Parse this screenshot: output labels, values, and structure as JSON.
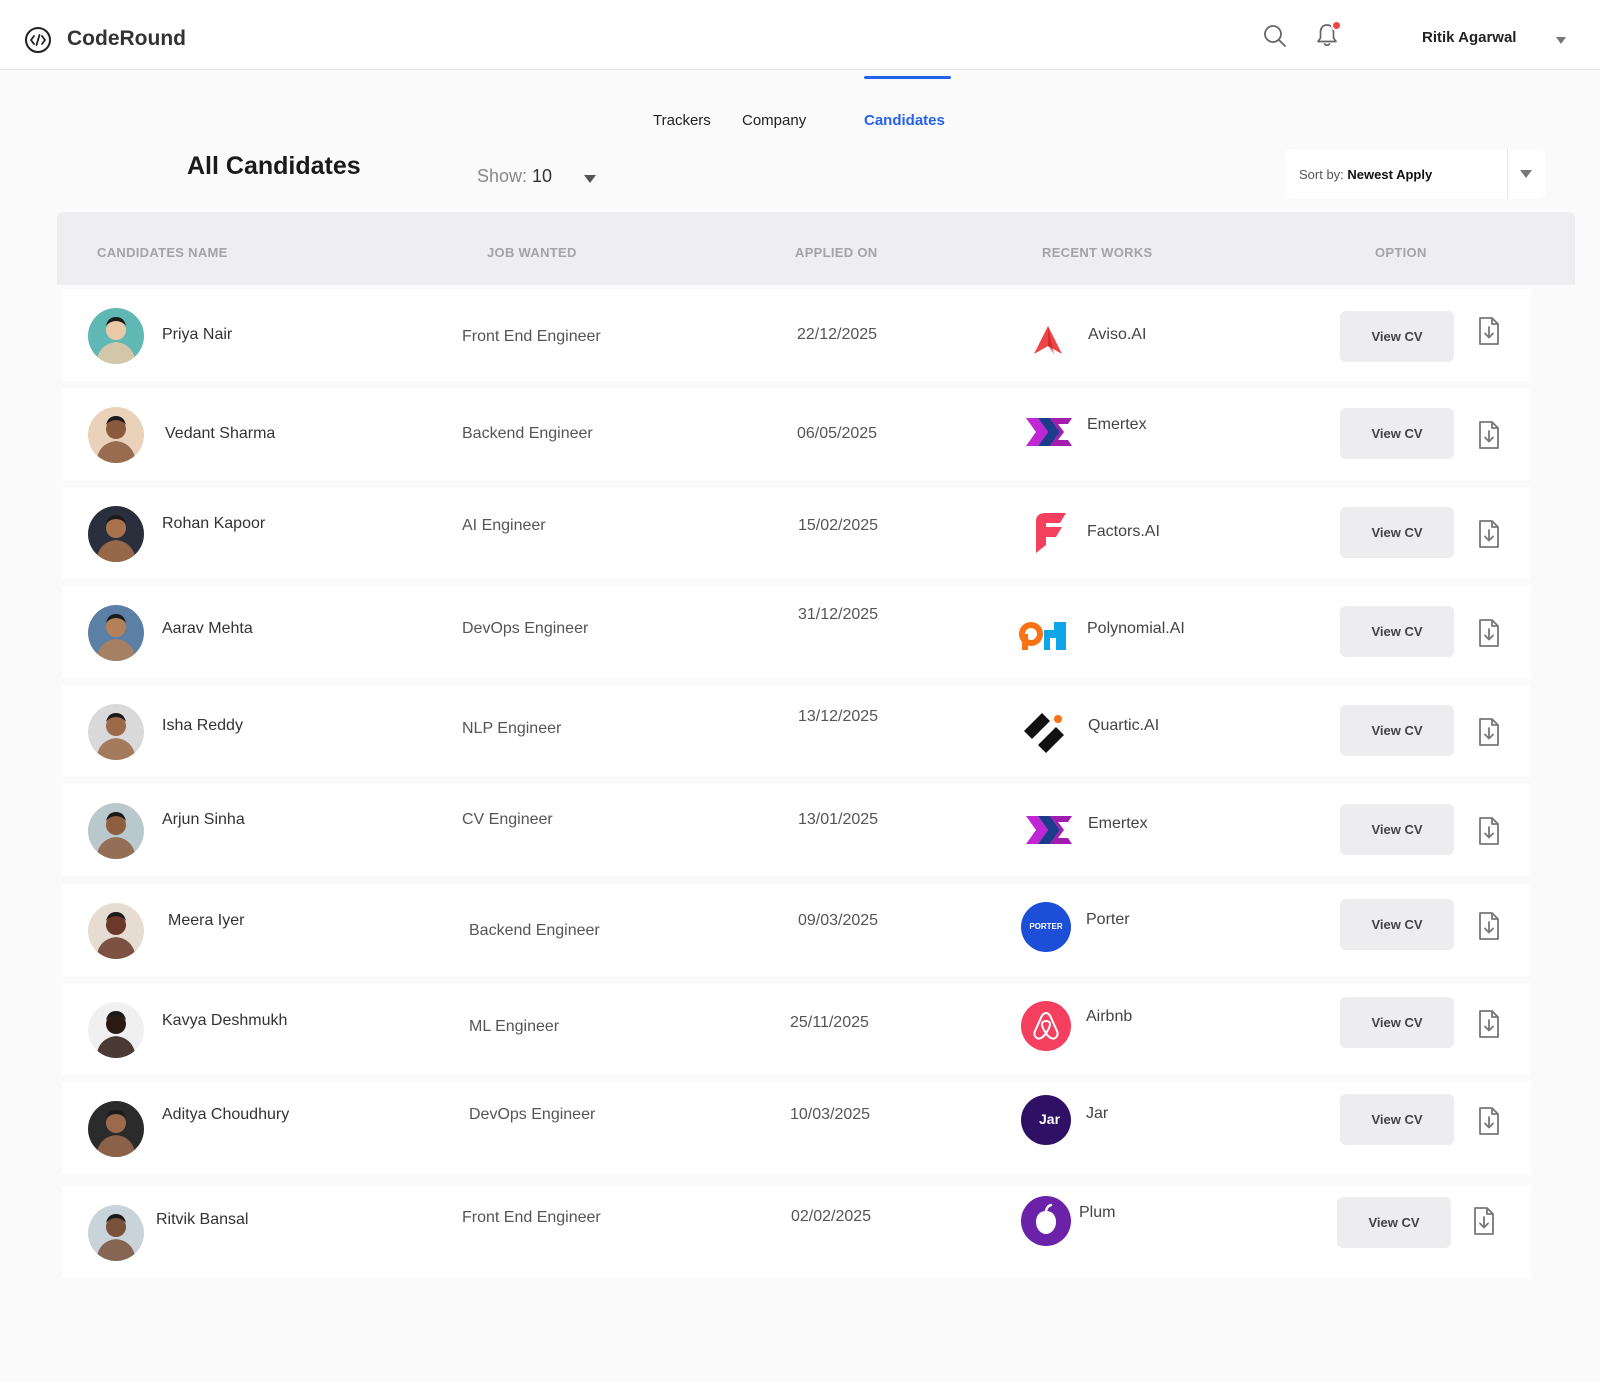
{
  "header": {
    "brand": "CodeRound",
    "user_name": "Ritik Agarwal"
  },
  "tabs": {
    "trackers": "Trackers",
    "company": "Company",
    "candidates": "Candidates"
  },
  "page": {
    "title": "All Candidates",
    "show_label": "Show:",
    "show_value": "10",
    "sort_label": "Sort by:",
    "sort_value": "Newest Apply"
  },
  "table": {
    "columns": [
      "CANDIDATES NAME",
      "JOB WANTED",
      "APPLIED ON",
      "RECENT WORKS",
      "OPTION"
    ],
    "view_cv_label": "View CV",
    "rows": [
      {
        "name": "Priya Nair",
        "job": "Front End Engineer",
        "date": "22/12/2025",
        "company": "Aviso.AI",
        "logo": "aviso-logo"
      },
      {
        "name": "Vedant Sharma",
        "job": "Backend Engineer",
        "date": "06/05/2025",
        "company": "Emertex",
        "logo": "emertex-logo"
      },
      {
        "name": "Rohan Kapoor",
        "job": "AI Engineer",
        "date": "15/02/2025",
        "company": "Factors.AI",
        "logo": "factors-logo"
      },
      {
        "name": "Aarav Mehta",
        "job": "DevOps Engineer",
        "date": "31/12/2025",
        "company": "Polynomial.AI",
        "logo": "polynomial-logo"
      },
      {
        "name": "Isha Reddy",
        "job": "NLP Engineer",
        "date": "13/12/2025",
        "company": "Quartic.AI",
        "logo": "quartic-logo"
      },
      {
        "name": "Arjun Sinha",
        "job": "CV Engineer",
        "date": "13/01/2025",
        "company": "Emertex",
        "logo": "emertex-logo"
      },
      {
        "name": "Meera Iyer",
        "job": "Backend Engineer",
        "date": "09/03/2025",
        "company": "Porter",
        "logo": "porter-logo",
        "logo_text": "PORTER"
      },
      {
        "name": "Kavya Deshmukh",
        "job": "ML Engineer",
        "date": "25/11/2025",
        "company": "Airbnb",
        "logo": "airbnb-logo"
      },
      {
        "name": "Aditya Choudhury",
        "job": "DevOps Engineer",
        "date": "10/03/2025",
        "company": "Jar",
        "logo": "jar-logo",
        "logo_text": "Jar"
      },
      {
        "name": "Ritvik Bansal",
        "job": "Front End Engineer",
        "date": "02/02/2025",
        "company": "Plum",
        "logo": "plum-logo"
      }
    ]
  },
  "colors": {
    "accent": "#2563eb",
    "notification": "#ef4444",
    "aviso": "#ef4444",
    "emertex": "#c026d3",
    "factors": "#f43f5e",
    "polynomial_orange": "#f97316",
    "polynomial_cyan": "#0ea5e9",
    "porter": "#1d4ed8",
    "airbnb": "#f43f5e",
    "jar": "#2e1065",
    "plum": "#6b21a8"
  }
}
